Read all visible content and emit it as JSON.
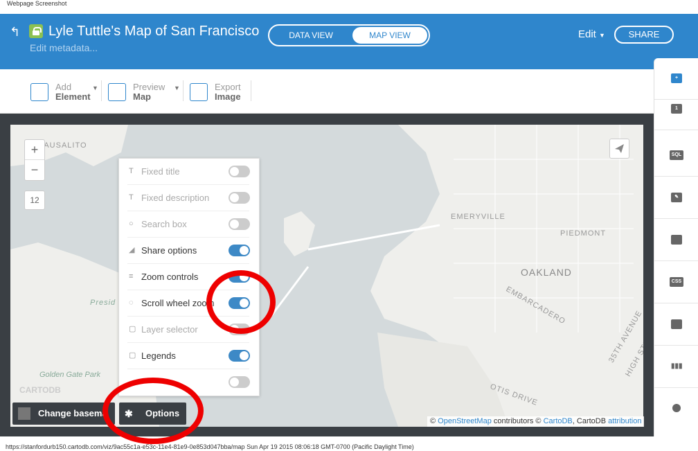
{
  "captions": {
    "top": "Webpage Screenshot",
    "bottom": "https://stanfordurb150.cartodb.com/viz/9ac55c1a-e53c-11e4-81e9-0e853d047bba/map Sun Apr 19 2015 08:06:18 GMT-0700 (Pacific Daylight Time)"
  },
  "header": {
    "title": "Lyle Tuttle's Map of San Francisco",
    "subtitle": "Edit metadata...",
    "tabs": [
      "DATA VIEW",
      "MAP VIEW"
    ],
    "edit_label": "Edit",
    "share_label": "SHARE",
    "accent_color": "#2f86cc"
  },
  "toolbar": {
    "items": [
      {
        "line1": "Add",
        "line2": "Element",
        "icon": "add-element-icon"
      },
      {
        "line1": "Preview",
        "line2": "Map",
        "icon": "preview-icon"
      },
      {
        "line1": "Export",
        "line2": "Image",
        "icon": "image-icon"
      }
    ]
  },
  "map": {
    "zoom_in": "+",
    "zoom_out": "−",
    "zoom_level": "12",
    "places": [
      "SAUSALITO",
      "EMERYVILLE",
      "PIEDMONT",
      "OAKLAND",
      "Presid",
      "Golden Gate Park",
      "EMBARCADERO",
      "35TH AVENUE",
      "HIGH STREET",
      "OTIS DRIVE"
    ],
    "logo": "CARTODB",
    "basemap_label": "Change basema",
    "options_label": "Options",
    "attribution": {
      "copy1": "©",
      "osm": "OpenStreetMap",
      "contributors": "contributors ©",
      "cartodb": "CartoDB",
      "comma": ", CartoDB",
      "attr": "attribution"
    }
  },
  "options_panel": {
    "rows": [
      {
        "label": "Fixed title",
        "on": false,
        "enabled": false,
        "icon": "T"
      },
      {
        "label": "Fixed description",
        "on": false,
        "enabled": false,
        "icon": "T"
      },
      {
        "label": "Search box",
        "on": false,
        "enabled": false,
        "icon": "○"
      },
      {
        "label": "Share options",
        "on": true,
        "enabled": true,
        "icon": "◢"
      },
      {
        "label": "Zoom controls",
        "on": true,
        "enabled": true,
        "icon": "≡"
      },
      {
        "label": "Scroll wheel zoom",
        "on": true,
        "enabled": true,
        "icon": "◌"
      },
      {
        "label": "Layer selector",
        "on": false,
        "enabled": false,
        "icon": "▢"
      },
      {
        "label": "Legends",
        "on": true,
        "enabled": true,
        "icon": "▢"
      },
      {
        "label": "",
        "on": false,
        "enabled": false,
        "icon": ""
      }
    ]
  },
  "sidebar": {
    "items": [
      "+",
      "1",
      "SQL",
      "✎",
      "💬",
      "CSS",
      "▬",
      "▮▮▮",
      "●"
    ]
  }
}
